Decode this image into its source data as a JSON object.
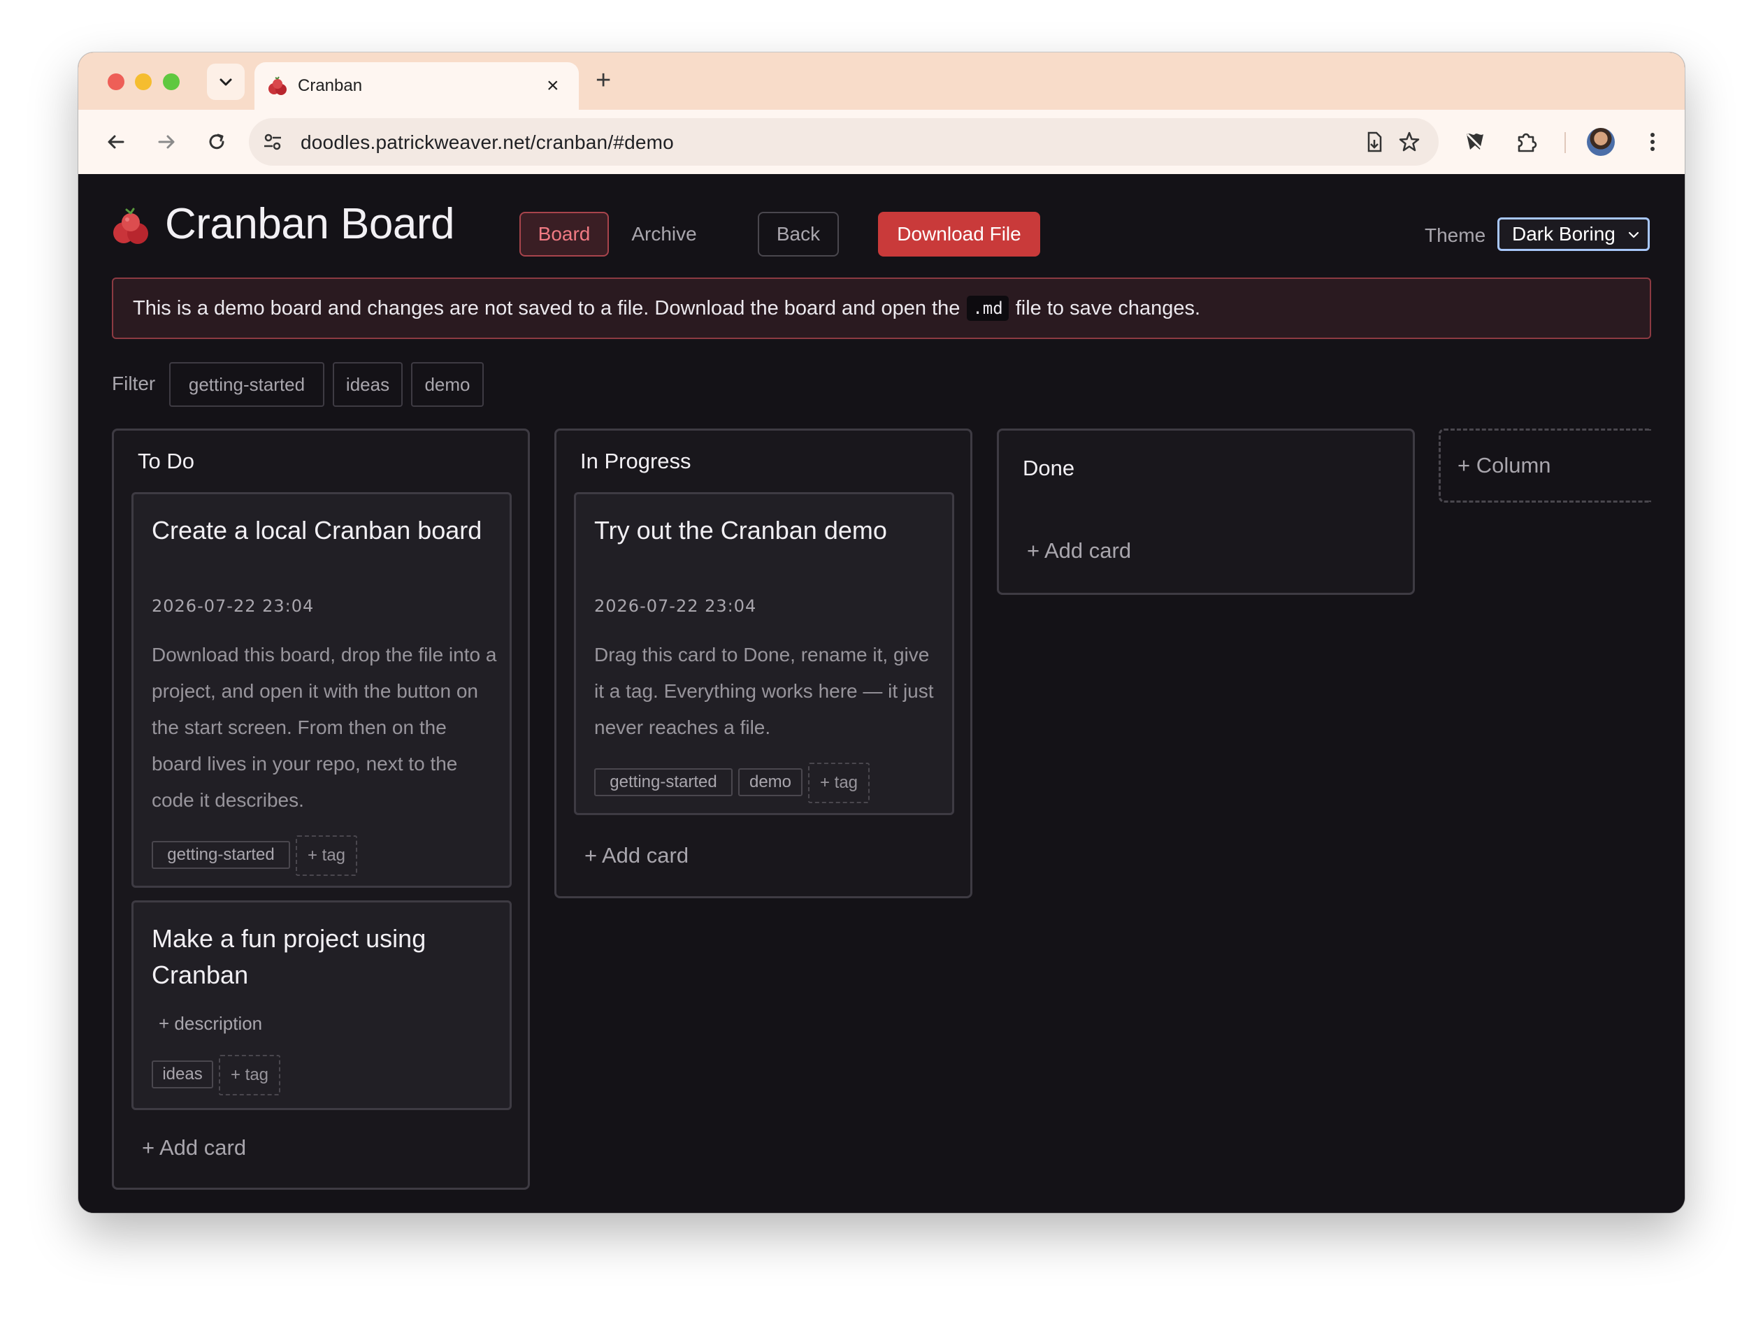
{
  "browser": {
    "tab_title": "Cranban",
    "url": "doodles.patrickweaver.net/cranban/#demo"
  },
  "app": {
    "title": "Cranban Board",
    "nav": {
      "board": "Board",
      "archive": "Archive",
      "back": "Back",
      "download": "Download File"
    },
    "theme_label": "Theme",
    "theme_value": "Dark Boring"
  },
  "notice": {
    "before": "This is a demo board and changes are not saved to a file. Download the board and open the",
    "code": ".md",
    "after": "file to save changes."
  },
  "filter": {
    "label": "Filter",
    "tags": [
      "getting-started",
      "ideas",
      "demo"
    ]
  },
  "columns": [
    {
      "title": "To Do",
      "cards": [
        {
          "title": "Create a local Cranban board",
          "date": "2026-07-22 23:04",
          "description": "Download this board, drop the file into a project, and open it with the button on the start screen. From then on the board lives in your repo, next to the code it describes.",
          "tags": [
            "getting-started"
          ],
          "add_tag": "+ tag"
        },
        {
          "title": "Make a fun project using Cranban",
          "add_description": "+ description",
          "tags": [
            "ideas"
          ],
          "add_tag": "+ tag"
        }
      ],
      "add_card": "+ Add card"
    },
    {
      "title": "In Progress",
      "cards": [
        {
          "title": "Try out the Cranban demo",
          "date": "2026-07-22 23:04",
          "description": "Drag this card to Done, rename it, give it a tag. Everything works here — it just never reaches a file.",
          "tags": [
            "getting-started",
            "demo"
          ],
          "add_tag": "+ tag"
        }
      ],
      "add_card": "+ Add card"
    },
    {
      "title": "Done",
      "cards": [],
      "add_card": "+ Add card"
    }
  ],
  "add_column": "+ Column",
  "colors": {
    "accent": "#c93a3a",
    "background": "#141217",
    "tab_bar": "#f8dcc9"
  }
}
